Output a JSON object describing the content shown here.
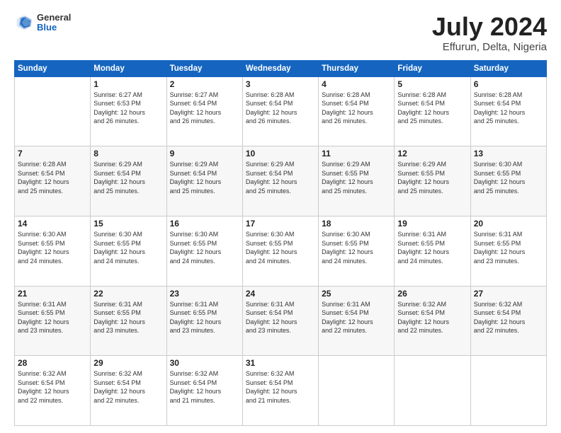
{
  "header": {
    "logo": {
      "general": "General",
      "blue": "Blue"
    },
    "title": "July 2024",
    "location": "Effurun, Delta, Nigeria"
  },
  "calendar": {
    "days_of_week": [
      "Sunday",
      "Monday",
      "Tuesday",
      "Wednesday",
      "Thursday",
      "Friday",
      "Saturday"
    ],
    "weeks": [
      [
        {
          "day": "",
          "info": ""
        },
        {
          "day": "1",
          "info": "Sunrise: 6:27 AM\nSunset: 6:53 PM\nDaylight: 12 hours\nand 26 minutes."
        },
        {
          "day": "2",
          "info": "Sunrise: 6:27 AM\nSunset: 6:54 PM\nDaylight: 12 hours\nand 26 minutes."
        },
        {
          "day": "3",
          "info": "Sunrise: 6:28 AM\nSunset: 6:54 PM\nDaylight: 12 hours\nand 26 minutes."
        },
        {
          "day": "4",
          "info": "Sunrise: 6:28 AM\nSunset: 6:54 PM\nDaylight: 12 hours\nand 26 minutes."
        },
        {
          "day": "5",
          "info": "Sunrise: 6:28 AM\nSunset: 6:54 PM\nDaylight: 12 hours\nand 25 minutes."
        },
        {
          "day": "6",
          "info": "Sunrise: 6:28 AM\nSunset: 6:54 PM\nDaylight: 12 hours\nand 25 minutes."
        }
      ],
      [
        {
          "day": "7",
          "info": "Sunrise: 6:28 AM\nSunset: 6:54 PM\nDaylight: 12 hours\nand 25 minutes."
        },
        {
          "day": "8",
          "info": "Sunrise: 6:29 AM\nSunset: 6:54 PM\nDaylight: 12 hours\nand 25 minutes."
        },
        {
          "day": "9",
          "info": "Sunrise: 6:29 AM\nSunset: 6:54 PM\nDaylight: 12 hours\nand 25 minutes."
        },
        {
          "day": "10",
          "info": "Sunrise: 6:29 AM\nSunset: 6:54 PM\nDaylight: 12 hours\nand 25 minutes."
        },
        {
          "day": "11",
          "info": "Sunrise: 6:29 AM\nSunset: 6:55 PM\nDaylight: 12 hours\nand 25 minutes."
        },
        {
          "day": "12",
          "info": "Sunrise: 6:29 AM\nSunset: 6:55 PM\nDaylight: 12 hours\nand 25 minutes."
        },
        {
          "day": "13",
          "info": "Sunrise: 6:30 AM\nSunset: 6:55 PM\nDaylight: 12 hours\nand 25 minutes."
        }
      ],
      [
        {
          "day": "14",
          "info": "Sunrise: 6:30 AM\nSunset: 6:55 PM\nDaylight: 12 hours\nand 24 minutes."
        },
        {
          "day": "15",
          "info": "Sunrise: 6:30 AM\nSunset: 6:55 PM\nDaylight: 12 hours\nand 24 minutes."
        },
        {
          "day": "16",
          "info": "Sunrise: 6:30 AM\nSunset: 6:55 PM\nDaylight: 12 hours\nand 24 minutes."
        },
        {
          "day": "17",
          "info": "Sunrise: 6:30 AM\nSunset: 6:55 PM\nDaylight: 12 hours\nand 24 minutes."
        },
        {
          "day": "18",
          "info": "Sunrise: 6:30 AM\nSunset: 6:55 PM\nDaylight: 12 hours\nand 24 minutes."
        },
        {
          "day": "19",
          "info": "Sunrise: 6:31 AM\nSunset: 6:55 PM\nDaylight: 12 hours\nand 24 minutes."
        },
        {
          "day": "20",
          "info": "Sunrise: 6:31 AM\nSunset: 6:55 PM\nDaylight: 12 hours\nand 23 minutes."
        }
      ],
      [
        {
          "day": "21",
          "info": "Sunrise: 6:31 AM\nSunset: 6:55 PM\nDaylight: 12 hours\nand 23 minutes."
        },
        {
          "day": "22",
          "info": "Sunrise: 6:31 AM\nSunset: 6:55 PM\nDaylight: 12 hours\nand 23 minutes."
        },
        {
          "day": "23",
          "info": "Sunrise: 6:31 AM\nSunset: 6:55 PM\nDaylight: 12 hours\nand 23 minutes."
        },
        {
          "day": "24",
          "info": "Sunrise: 6:31 AM\nSunset: 6:54 PM\nDaylight: 12 hours\nand 23 minutes."
        },
        {
          "day": "25",
          "info": "Sunrise: 6:31 AM\nSunset: 6:54 PM\nDaylight: 12 hours\nand 22 minutes."
        },
        {
          "day": "26",
          "info": "Sunrise: 6:32 AM\nSunset: 6:54 PM\nDaylight: 12 hours\nand 22 minutes."
        },
        {
          "day": "27",
          "info": "Sunrise: 6:32 AM\nSunset: 6:54 PM\nDaylight: 12 hours\nand 22 minutes."
        }
      ],
      [
        {
          "day": "28",
          "info": "Sunrise: 6:32 AM\nSunset: 6:54 PM\nDaylight: 12 hours\nand 22 minutes."
        },
        {
          "day": "29",
          "info": "Sunrise: 6:32 AM\nSunset: 6:54 PM\nDaylight: 12 hours\nand 22 minutes."
        },
        {
          "day": "30",
          "info": "Sunrise: 6:32 AM\nSunset: 6:54 PM\nDaylight: 12 hours\nand 21 minutes."
        },
        {
          "day": "31",
          "info": "Sunrise: 6:32 AM\nSunset: 6:54 PM\nDaylight: 12 hours\nand 21 minutes."
        },
        {
          "day": "",
          "info": ""
        },
        {
          "day": "",
          "info": ""
        },
        {
          "day": "",
          "info": ""
        }
      ]
    ]
  }
}
